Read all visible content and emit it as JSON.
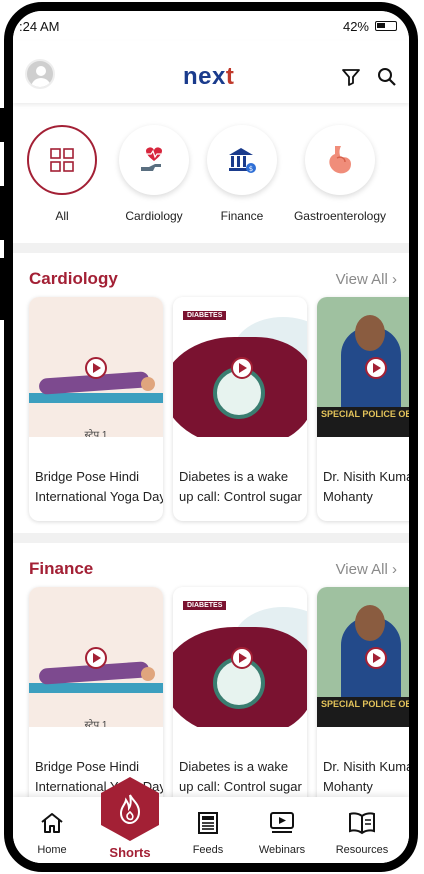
{
  "status": {
    "time": ":24 AM",
    "battery": "42%"
  },
  "header": {
    "logo_main": "nex",
    "logo_accent": "t"
  },
  "categories": [
    {
      "label": "All"
    },
    {
      "label": "Cardiology"
    },
    {
      "label": "Finance"
    },
    {
      "label": "Gastroenterology"
    }
  ],
  "sections": [
    {
      "title": "Cardiology",
      "view_all": "View All",
      "cards": [
        {
          "line1": "Bridge Pose Hindi",
          "line2": "International Yoga Day",
          "thumb_text": "स्टेप 1"
        },
        {
          "line1": "Diabetes is a wake",
          "line2": "up call: Control sugar",
          "thumb_text": "DIABETES"
        },
        {
          "line1": "Dr. Nisith Kumar",
          "line2": "Mohanty",
          "thumb_text": "SPECIAL POLICE OBS"
        }
      ]
    },
    {
      "title": "Finance",
      "view_all": "View All",
      "cards": [
        {
          "line1": "Bridge Pose Hindi",
          "line2": "International Yoga Day",
          "thumb_text": "स्टेप 1"
        },
        {
          "line1": "Diabetes is a wake",
          "line2": "up call: Control sugar",
          "thumb_text": "DIABETES"
        },
        {
          "line1": "Dr. Nisith Kumar",
          "line2": "Mohanty",
          "thumb_text": "SPECIAL POLICE OBS"
        }
      ]
    }
  ],
  "nav": {
    "home": "Home",
    "shorts": "Shorts",
    "feeds": "Feeds",
    "webinars": "Webinars",
    "resources": "Resources"
  },
  "colors": {
    "accent": "#a32035",
    "brand": "#1a3b8c"
  }
}
